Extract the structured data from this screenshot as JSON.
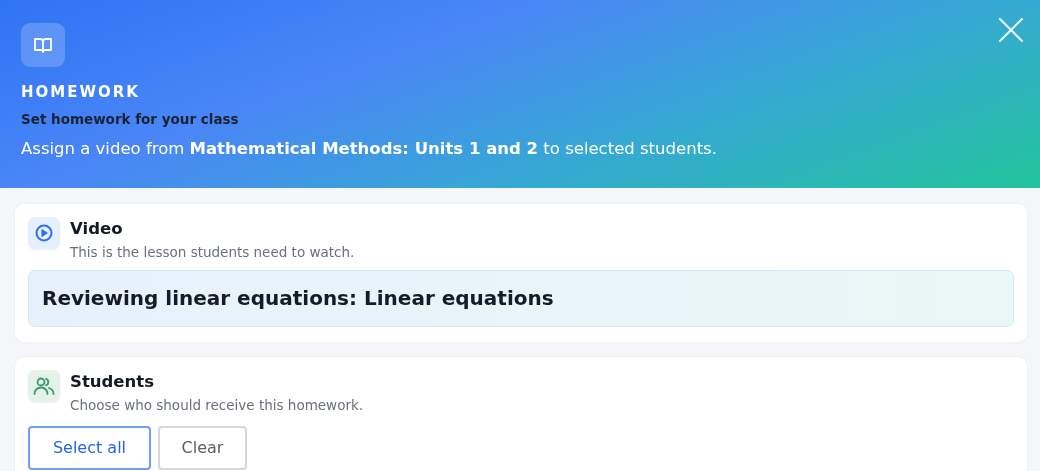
{
  "header": {
    "eyebrow": "HOMEWORK",
    "title": "Set homework for your class",
    "description": "Assign a video from **Mathematical Methods: Units 1 and 2** to selected students."
  },
  "sections": [
    {
      "kind": "video",
      "title": "Video",
      "subtitle": "This is the lesson students need to watch.",
      "video_title": "Reviewing linear equations: Linear equations"
    },
    {
      "kind": "students",
      "title": "Students",
      "subtitle": "Choose who should receive this homework.",
      "buttons": [
        {
          "label": "Select all",
          "kind": "primary"
        },
        {
          "label": "Clear",
          "kind": "secondary"
        }
      ]
    }
  ]
}
